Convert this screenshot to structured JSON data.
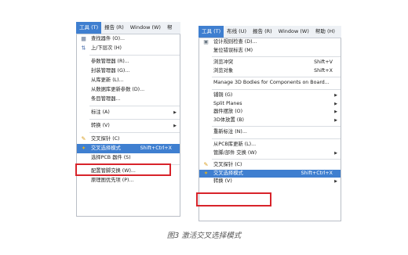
{
  "left_window": {
    "menubar": [
      {
        "label": "工具 (T)",
        "active": true
      },
      {
        "label": "报告 (R)"
      },
      {
        "label": "Window (W)"
      },
      {
        "label": "帮"
      }
    ],
    "items": [
      {
        "label": "查找器件 (O)...",
        "icon": "find-icon"
      },
      {
        "label": "上/下层次 (H)",
        "icon": "hierarchy-icon"
      },
      {
        "sep": true
      },
      {
        "label": "参数管理器 (R)..."
      },
      {
        "label": "封装管理器 (G)..."
      },
      {
        "label": "从库更新 (L)..."
      },
      {
        "label": "从数据库更新参数 (D)..."
      },
      {
        "label": "条目管理器..."
      },
      {
        "sep": true
      },
      {
        "label": "标注 (A)",
        "arrow": true
      },
      {
        "sep": true
      },
      {
        "label": "转换 (V)",
        "arrow": true
      },
      {
        "sep": true
      },
      {
        "label": "交叉探针 (C)",
        "icon": "probe-icon"
      },
      {
        "label": "交叉选择模式",
        "shortcut": "Shift+Ctrl+X",
        "icon": "cross-select-icon",
        "highlight": true
      },
      {
        "label": "选择PCB 器件 (S)"
      },
      {
        "sep": true
      },
      {
        "label": "配置管脚交换 (W)..."
      },
      {
        "label": "原理图优先项 (P)..."
      }
    ]
  },
  "right_window": {
    "menubar": [
      {
        "label": "工具 (T)",
        "active": true
      },
      {
        "label": "布线 (U)"
      },
      {
        "label": "报告 (R)"
      },
      {
        "label": "Window (W)"
      },
      {
        "label": "帮助 (H)"
      }
    ],
    "items": [
      {
        "label": "设计规则检查 (D)...",
        "icon": "drc-icon"
      },
      {
        "label": "复位错误标志 (M)"
      },
      {
        "sep": true
      },
      {
        "label": "浏览冲突",
        "shortcut": "Shift+V"
      },
      {
        "label": "浏览对象",
        "shortcut": "Shift+X"
      },
      {
        "sep": true
      },
      {
        "label": "Manage 3D Bodies for Components on Board..."
      },
      {
        "sep": true
      },
      {
        "label": "铺铜 (G)",
        "arrow": true
      },
      {
        "label": "Split Planes",
        "arrow": true
      },
      {
        "label": "器件摆放 (O)",
        "arrow": true
      },
      {
        "label": "3D体放置 (B)",
        "arrow": true
      },
      {
        "sep": true
      },
      {
        "label": "重新标注 (N)..."
      },
      {
        "sep": true
      },
      {
        "label": "从PCB库更新 (L)..."
      },
      {
        "label": "管脚/部件 交换 (W)",
        "arrow": true
      },
      {
        "sep": true
      },
      {
        "label": "交叉探针 (C)",
        "icon": "probe-icon"
      },
      {
        "label": "交叉选择模式",
        "shortcut": "Shift+Ctrl+X",
        "icon": "cross-select-icon",
        "highlight": true
      },
      {
        "label": "转换 (V)",
        "arrow": true
      }
    ]
  },
  "caption": "图3 激活交叉选择模式",
  "colors": {
    "highlight": "#3f7fd0",
    "redbox": "#d8232a"
  }
}
